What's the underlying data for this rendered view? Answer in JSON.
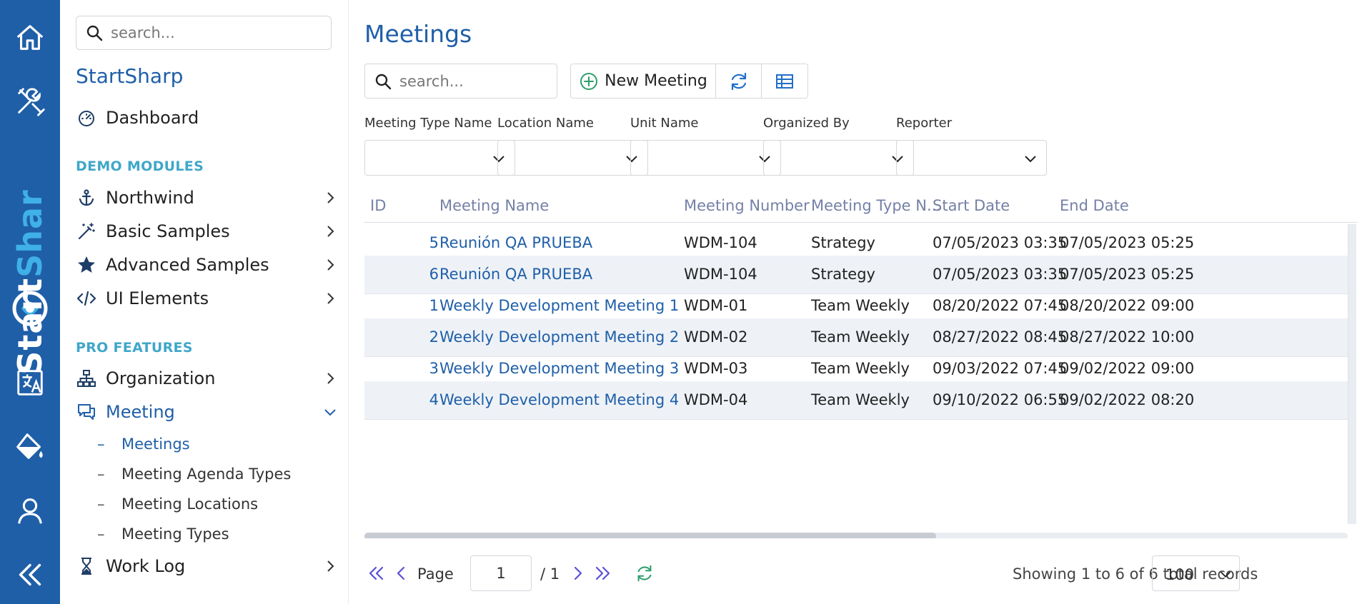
{
  "rail": {
    "brand_start": "Start",
    "brand_sharp": "Shar",
    "items": [
      "home-icon",
      "tools-icon",
      "translate-icon",
      "paint-bucket-icon",
      "user-icon",
      "collapse-icon"
    ]
  },
  "sidebar": {
    "search_placeholder": "search...",
    "app_title": "StartSharp",
    "dashboard": "Dashboard",
    "section_demo": "DEMO MODULES",
    "demo_items": [
      "Northwind",
      "Basic Samples",
      "Advanced Samples",
      "UI Elements"
    ],
    "section_pro": "PRO FEATURES",
    "pro_items": [
      "Organization",
      "Meeting",
      "Work Log"
    ],
    "meeting_sub": [
      "Meetings",
      "Meeting Agenda Types",
      "Meeting Locations",
      "Meeting Types"
    ],
    "sub_dash": "–"
  },
  "main": {
    "title": "Meetings",
    "search_placeholder": "search...",
    "new_button": "New Meeting",
    "filters": [
      "Meeting Type Name",
      "Location Name",
      "Unit Name",
      "Organized By",
      "Reporter"
    ],
    "columns": [
      "ID",
      "Meeting Name",
      "Meeting Number",
      "Meeting Type N...",
      "Start Date",
      "End Date"
    ],
    "rows": [
      {
        "id": "5",
        "name": "Reunión QA PRUEBA",
        "number": "WDM-104",
        "type": "Strategy",
        "start": "07/05/2023 03:35",
        "end": "07/05/2023 05:25"
      },
      {
        "id": "6",
        "name": "Reunión QA PRUEBA",
        "number": "WDM-104",
        "type": "Strategy",
        "start": "07/05/2023 03:35",
        "end": "07/05/2023 05:25"
      },
      {
        "id": "1",
        "name": "Weekly Development Meeting 1",
        "number": "WDM-01",
        "type": "Team Weekly",
        "start": "08/20/2022 07:45",
        "end": "08/20/2022 09:00"
      },
      {
        "id": "2",
        "name": "Weekly Development Meeting 2",
        "number": "WDM-02",
        "type": "Team Weekly",
        "start": "08/27/2022 08:45",
        "end": "08/27/2022 10:00"
      },
      {
        "id": "3",
        "name": "Weekly Development Meeting 3",
        "number": "WDM-03",
        "type": "Team Weekly",
        "start": "09/03/2022 07:45",
        "end": "09/02/2022 09:00"
      },
      {
        "id": "4",
        "name": "Weekly Development Meeting 4",
        "number": "WDM-04",
        "type": "Team Weekly",
        "start": "09/10/2022 06:55",
        "end": "09/02/2022 08:20"
      }
    ],
    "pager": {
      "page_label": "Page",
      "page_value": "1",
      "page_total": "/ 1",
      "info": "Showing 1 to 6 of 6 total records",
      "page_size": "100"
    }
  },
  "colors": {
    "brand_blue": "#1f5fa8",
    "section_teal": "#3fa7c9",
    "header_text": "#7580a6",
    "alt_row": "#eef2f7",
    "refresh_green": "#2e9d6c",
    "pager_purple": "#5b4fd6"
  }
}
